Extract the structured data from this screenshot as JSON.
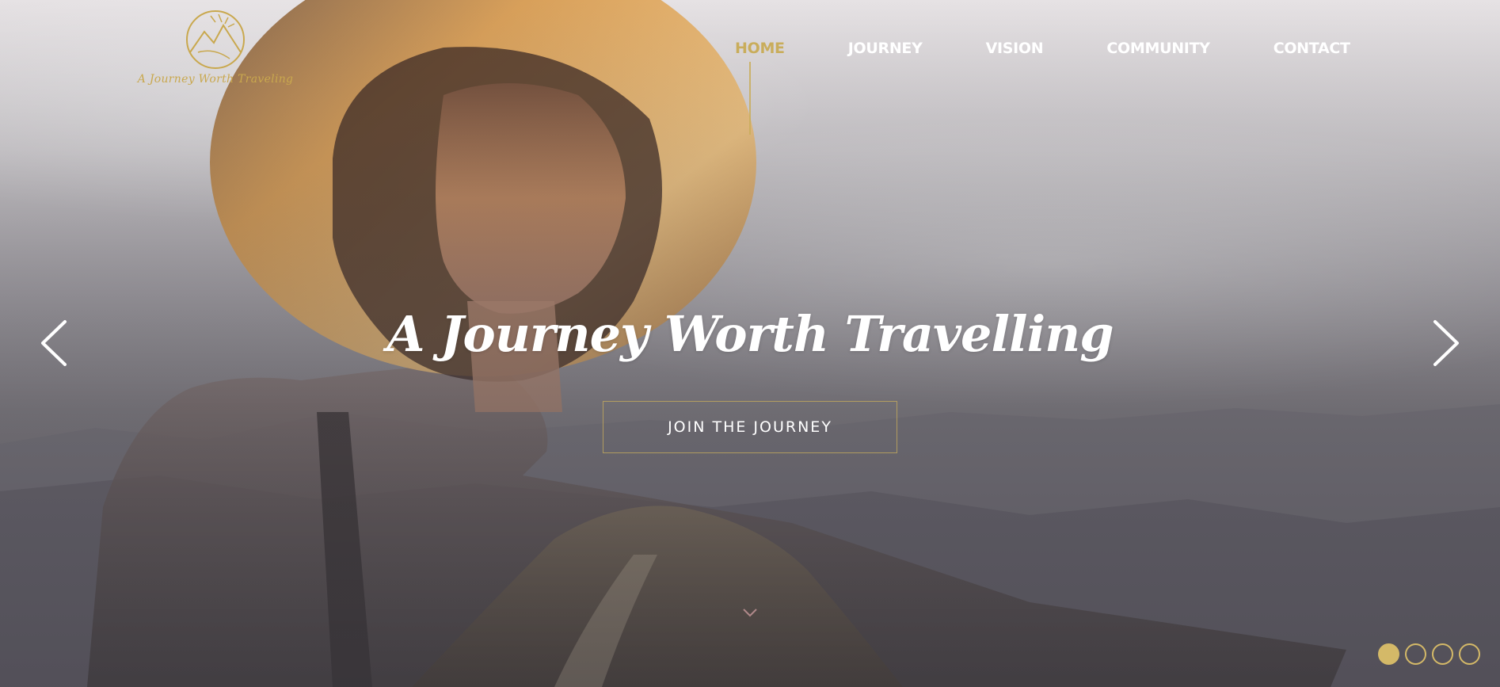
{
  "colors": {
    "accent": "#c9ad5b",
    "text_light": "#ffffff"
  },
  "brand": {
    "logo_icon": "mountain-sun-circle-icon",
    "logo_text": "A Journey Worth Traveling"
  },
  "nav": {
    "items": [
      {
        "label": "HOME",
        "active": true
      },
      {
        "label": "JOURNEY",
        "active": false
      },
      {
        "label": "VISION",
        "active": false
      },
      {
        "label": "COMMUNITY",
        "active": false
      },
      {
        "label": "CONTACT",
        "active": false
      }
    ]
  },
  "hero": {
    "headline": "A Journey Worth Travelling",
    "cta_label": "JOIN THE JOURNEY",
    "prev_icon": "chevron-left-icon",
    "next_icon": "chevron-right-icon",
    "scroll_icon": "chevron-down-icon"
  },
  "slider": {
    "total_slides": 4,
    "active_slide": 1
  }
}
